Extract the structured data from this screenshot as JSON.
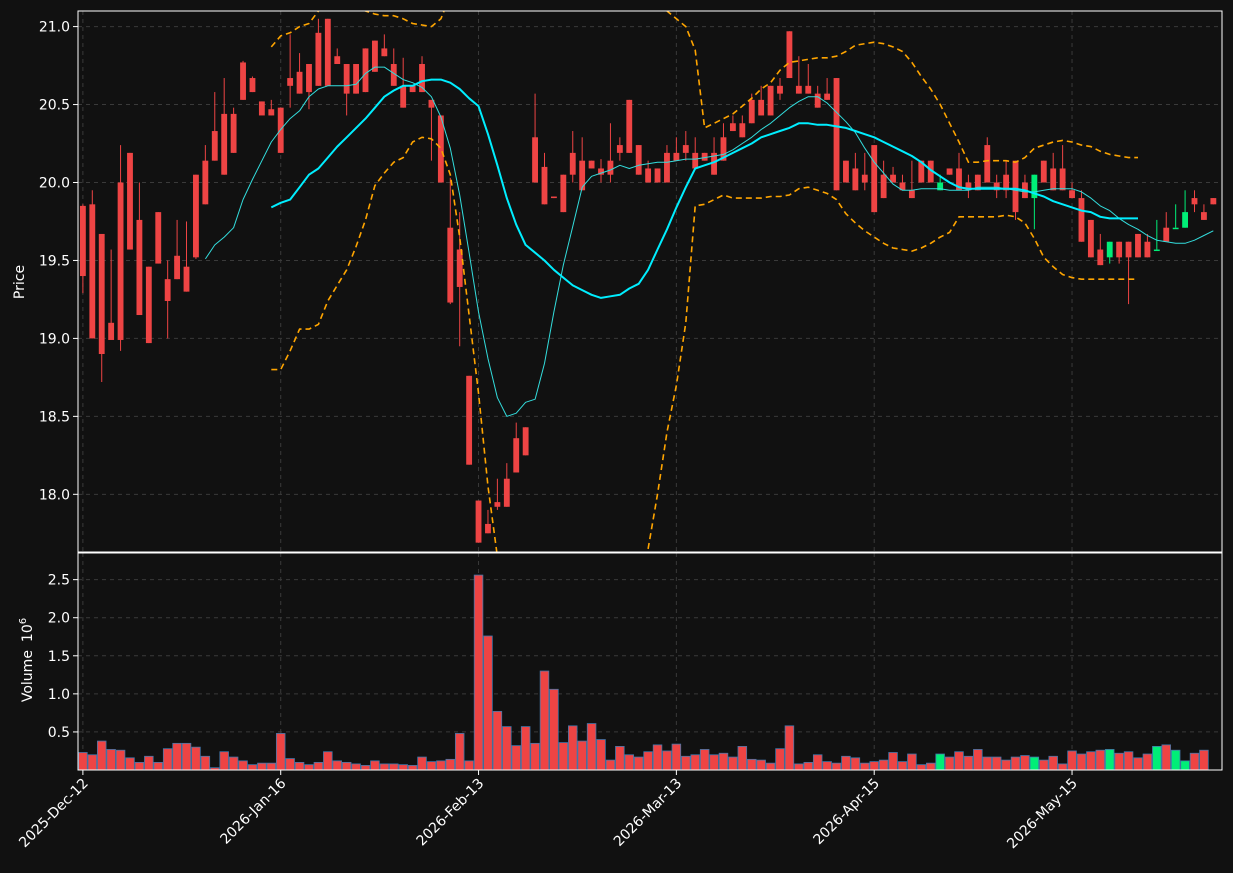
{
  "chart_data": {
    "type": "candlestick",
    "colors": {
      "background": "#111111",
      "up": "#00ee77",
      "down": "#ee4444",
      "ma_fast": "#33dddd",
      "ma_slow": "#00eeff",
      "band": "#ffa500",
      "volume_edge": "#4477aa"
    },
    "price_axis": {
      "label": "Price",
      "ylim": [
        17.63,
        21.1
      ],
      "ticks": [
        "18.0",
        "18.5",
        "19.0",
        "19.5",
        "20.0",
        "20.5",
        "21.0"
      ]
    },
    "volume_axis": {
      "label": "Volume",
      "exponent_label": "10",
      "exponent_power": "6",
      "ylim": [
        0,
        2.85
      ],
      "ticks": [
        "0.5",
        "1.0",
        "1.5",
        "2.0",
        "2.5"
      ]
    },
    "date_ticks": [
      {
        "index": 0,
        "label": "2025-Dec-12"
      },
      {
        "index": 21,
        "label": "2026-Jan-16"
      },
      {
        "index": 42,
        "label": "2026-Feb-13"
      },
      {
        "index": 63,
        "label": "2026-Mar-13"
      },
      {
        "index": 84,
        "label": "2026-Apr-15"
      },
      {
        "index": 105,
        "label": "2026-May-15"
      }
    ],
    "grid": true,
    "candles": [
      [
        19.85,
        19.86,
        19.29,
        19.4
      ],
      [
        19.86,
        19.95,
        19.0,
        19.0
      ],
      [
        19.67,
        19.67,
        18.72,
        18.9
      ],
      [
        19.1,
        19.57,
        19.0,
        18.99
      ],
      [
        20.0,
        20.24,
        18.92,
        18.99
      ],
      [
        20.19,
        20.19,
        19.57,
        19.57
      ],
      [
        19.76,
        20.0,
        19.15,
        19.15
      ],
      [
        19.46,
        19.46,
        18.97,
        18.97
      ],
      [
        19.81,
        19.81,
        19.48,
        19.48
      ],
      [
        19.38,
        19.5,
        19.0,
        19.24
      ],
      [
        19.53,
        19.76,
        19.38,
        19.38
      ],
      [
        19.46,
        19.75,
        19.3,
        19.3
      ],
      [
        20.05,
        20.05,
        19.51,
        19.52
      ],
      [
        20.14,
        20.24,
        19.86,
        19.86
      ],
      [
        20.33,
        20.58,
        20.14,
        20.14
      ],
      [
        20.44,
        20.67,
        20.05,
        20.05
      ],
      [
        20.44,
        20.48,
        20.19,
        20.19
      ],
      [
        20.77,
        20.78,
        20.53,
        20.53
      ],
      [
        20.67,
        20.68,
        20.58,
        20.58
      ],
      [
        20.52,
        20.52,
        20.44,
        20.43
      ],
      [
        20.47,
        20.53,
        20.43,
        20.43
      ],
      [
        20.48,
        20.48,
        20.19,
        20.19
      ],
      [
        20.67,
        20.95,
        20.48,
        20.62
      ],
      [
        20.71,
        20.83,
        20.57,
        20.57
      ],
      [
        20.76,
        20.76,
        20.47,
        20.58
      ],
      [
        20.96,
        21.05,
        20.62,
        20.62
      ],
      [
        21.05,
        21.05,
        20.62,
        20.62
      ],
      [
        20.81,
        20.86,
        20.76,
        20.76
      ],
      [
        20.76,
        20.76,
        20.43,
        20.57
      ],
      [
        20.76,
        20.76,
        20.57,
        20.57
      ],
      [
        20.86,
        20.86,
        20.58,
        20.58
      ],
      [
        20.91,
        20.91,
        20.71,
        20.71
      ],
      [
        20.86,
        20.95,
        20.81,
        20.81
      ],
      [
        20.76,
        20.86,
        20.62,
        20.62
      ],
      [
        20.62,
        20.8,
        20.48,
        20.48
      ],
      [
        20.62,
        20.62,
        20.58,
        20.58
      ],
      [
        20.76,
        20.81,
        20.58,
        20.58
      ],
      [
        20.53,
        20.53,
        20.14,
        20.48
      ],
      [
        20.43,
        20.43,
        20.0,
        20.0
      ],
      [
        19.71,
        20.03,
        19.22,
        19.23
      ],
      [
        19.57,
        19.81,
        18.95,
        19.33
      ],
      [
        18.76,
        18.76,
        18.19,
        18.19
      ],
      [
        17.96,
        17.96,
        17.69,
        17.69
      ],
      [
        17.81,
        17.9,
        17.75,
        17.75
      ],
      [
        17.95,
        18.1,
        17.9,
        17.92
      ],
      [
        18.1,
        18.2,
        17.92,
        17.92
      ],
      [
        18.36,
        18.46,
        18.14,
        18.14
      ],
      [
        18.43,
        18.43,
        18.25,
        18.25
      ],
      [
        20.29,
        20.57,
        20.0,
        20.0
      ],
      [
        20.1,
        20.19,
        19.86,
        19.86
      ],
      [
        19.91,
        19.91,
        19.9,
        19.9
      ],
      [
        20.05,
        20.05,
        19.81,
        19.81
      ],
      [
        20.19,
        20.33,
        20.0,
        20.05
      ],
      [
        20.14,
        20.29,
        19.95,
        19.95
      ],
      [
        20.14,
        20.14,
        20.09,
        20.09
      ],
      [
        20.09,
        20.15,
        20.0,
        20.05
      ],
      [
        20.14,
        20.38,
        20.0,
        20.05
      ],
      [
        20.24,
        20.29,
        20.14,
        20.19
      ],
      [
        20.53,
        20.53,
        20.19,
        20.19
      ],
      [
        20.24,
        20.24,
        20.05,
        20.05
      ],
      [
        20.09,
        20.14,
        20.0,
        20.0
      ],
      [
        20.09,
        20.09,
        20.0,
        20.0
      ],
      [
        20.19,
        20.24,
        20.0,
        20.0
      ],
      [
        20.19,
        20.29,
        20.14,
        20.14
      ],
      [
        20.24,
        20.33,
        20.14,
        20.19
      ],
      [
        20.19,
        20.29,
        20.09,
        20.09
      ],
      [
        20.19,
        20.19,
        20.14,
        20.14
      ],
      [
        20.19,
        20.29,
        20.05,
        20.05
      ],
      [
        20.29,
        20.38,
        20.14,
        20.14
      ],
      [
        20.38,
        20.43,
        20.33,
        20.33
      ],
      [
        20.38,
        20.43,
        20.29,
        20.29
      ],
      [
        20.53,
        20.57,
        20.38,
        20.38
      ],
      [
        20.53,
        20.62,
        20.43,
        20.43
      ],
      [
        20.62,
        20.62,
        20.43,
        20.43
      ],
      [
        20.62,
        20.67,
        20.53,
        20.57
      ],
      [
        20.97,
        20.97,
        20.67,
        20.67
      ],
      [
        20.62,
        20.81,
        20.57,
        20.57
      ],
      [
        20.62,
        20.76,
        20.57,
        20.57
      ],
      [
        20.57,
        20.62,
        20.48,
        20.48
      ],
      [
        20.57,
        20.67,
        20.53,
        20.53
      ],
      [
        20.67,
        20.67,
        19.95,
        19.95
      ],
      [
        20.14,
        20.14,
        20.0,
        20.0
      ],
      [
        20.09,
        20.19,
        19.95,
        19.95
      ],
      [
        20.05,
        20.19,
        19.95,
        20.0
      ],
      [
        20.24,
        20.24,
        19.81,
        19.81
      ],
      [
        20.05,
        20.14,
        19.9,
        19.9
      ],
      [
        20.05,
        20.1,
        20.0,
        20.0
      ],
      [
        20.0,
        20.05,
        19.95,
        19.95
      ],
      [
        19.95,
        20.14,
        19.9,
        19.9
      ],
      [
        20.14,
        20.14,
        20.0,
        20.0
      ],
      [
        20.14,
        20.14,
        20.0,
        20.0
      ],
      [
        19.95,
        20.05,
        19.95,
        20.0
      ],
      [
        20.09,
        20.09,
        20.05,
        20.05
      ],
      [
        20.09,
        20.19,
        19.95,
        19.95
      ],
      [
        20.0,
        20.05,
        19.9,
        19.95
      ],
      [
        20.05,
        20.05,
        19.95,
        19.95
      ],
      [
        20.24,
        20.29,
        20.0,
        20.0
      ],
      [
        20.0,
        20.05,
        19.9,
        19.95
      ],
      [
        20.05,
        20.14,
        19.9,
        19.95
      ],
      [
        20.14,
        20.14,
        19.76,
        19.81
      ],
      [
        20.0,
        20.05,
        19.9,
        19.9
      ],
      [
        19.9,
        20.05,
        19.7,
        20.05
      ],
      [
        20.14,
        20.14,
        20.0,
        20.0
      ],
      [
        20.09,
        20.19,
        19.95,
        19.95
      ],
      [
        20.09,
        20.24,
        19.95,
        19.95
      ],
      [
        19.95,
        20.0,
        19.9,
        19.9
      ],
      [
        19.9,
        19.95,
        19.62,
        19.62
      ],
      [
        19.76,
        19.76,
        19.52,
        19.52
      ],
      [
        19.57,
        19.67,
        19.47,
        19.47
      ],
      [
        19.52,
        19.62,
        19.48,
        19.62
      ],
      [
        19.62,
        19.62,
        19.48,
        19.52
      ],
      [
        19.62,
        19.62,
        19.22,
        19.52
      ],
      [
        19.67,
        19.67,
        19.52,
        19.52
      ],
      [
        19.62,
        19.67,
        19.52,
        19.52
      ],
      [
        19.57,
        19.76,
        19.57,
        19.57
      ],
      [
        19.71,
        19.81,
        19.62,
        19.62
      ],
      [
        19.71,
        19.86,
        19.71,
        19.71
      ],
      [
        19.71,
        19.95,
        19.71,
        19.81
      ],
      [
        19.9,
        19.95,
        19.81,
        19.86
      ],
      [
        19.81,
        19.86,
        19.76,
        19.76
      ],
      [
        19.9,
        19.9,
        19.86,
        19.86
      ]
    ],
    "volume": [
      0.23,
      0.2,
      0.38,
      0.27,
      0.26,
      0.16,
      0.1,
      0.18,
      0.1,
      0.28,
      0.35,
      0.35,
      0.3,
      0.18,
      0.03,
      0.24,
      0.17,
      0.12,
      0.07,
      0.09,
      0.09,
      0.48,
      0.15,
      0.1,
      0.07,
      0.1,
      0.24,
      0.12,
      0.1,
      0.08,
      0.06,
      0.12,
      0.08,
      0.08,
      0.07,
      0.06,
      0.17,
      0.11,
      0.12,
      0.14,
      0.48,
      0.12,
      2.56,
      1.76,
      0.77,
      0.57,
      0.32,
      0.57,
      0.35,
      1.3,
      1.06,
      0.36,
      0.58,
      0.38,
      0.61,
      0.4,
      0.13,
      0.31,
      0.2,
      0.17,
      0.24,
      0.33,
      0.25,
      0.34,
      0.18,
      0.2,
      0.27,
      0.2,
      0.22,
      0.17,
      0.31,
      0.14,
      0.13,
      0.09,
      0.28,
      0.58,
      0.08,
      0.1,
      0.2,
      0.11,
      0.09,
      0.18,
      0.16,
      0.09,
      0.11,
      0.13,
      0.23,
      0.11,
      0.21,
      0.07,
      0.09,
      0.21,
      0.17,
      0.24,
      0.18,
      0.27,
      0.17,
      0.17,
      0.13,
      0.17,
      0.19,
      0.17,
      0.13,
      0.18,
      0.08,
      0.25,
      0.21,
      0.24,
      0.26,
      0.27,
      0.22,
      0.24,
      0.16,
      0.21,
      0.31,
      0.33,
      0.26,
      0.12,
      0.22,
      0.26
    ],
    "ma_fast": [
      null,
      null,
      null,
      null,
      null,
      null,
      null,
      null,
      null,
      null,
      null,
      null,
      null,
      19.51,
      19.6,
      19.65,
      19.71,
      19.89,
      20.02,
      20.14,
      20.26,
      20.34,
      20.41,
      20.46,
      20.55,
      20.6,
      20.62,
      20.62,
      20.62,
      20.63,
      20.7,
      20.74,
      20.74,
      20.7,
      20.66,
      20.64,
      20.61,
      20.55,
      20.42,
      20.22,
      19.92,
      19.55,
      19.17,
      18.87,
      18.62,
      18.5,
      18.52,
      18.59,
      18.61,
      18.84,
      19.17,
      19.47,
      19.72,
      19.97,
      20.04,
      20.06,
      20.08,
      20.11,
      20.09,
      20.11,
      20.12,
      20.13,
      20.13,
      20.14,
      20.15,
      20.15,
      20.16,
      20.17,
      20.18,
      20.21,
      20.25,
      20.29,
      20.34,
      20.38,
      20.43,
      20.48,
      20.52,
      20.55,
      20.55,
      20.51,
      20.45,
      20.39,
      20.32,
      20.22,
      20.13,
      20.06,
      19.99,
      19.95,
      19.95,
      19.96,
      19.96,
      19.96,
      19.95,
      19.95,
      19.95,
      19.97,
      19.97,
      19.97,
      19.96,
      19.95,
      19.94,
      19.94,
      19.95,
      19.96,
      19.96,
      19.96,
      19.94,
      19.9,
      19.85,
      19.82,
      19.77,
      19.73,
      19.7,
      19.66,
      19.63,
      19.62,
      19.61,
      19.61,
      19.63,
      19.66,
      19.69
    ],
    "ma_slow": [
      null,
      null,
      null,
      null,
      null,
      null,
      null,
      null,
      null,
      null,
      null,
      null,
      null,
      null,
      null,
      null,
      null,
      null,
      null,
      null,
      19.84,
      19.87,
      19.89,
      19.97,
      20.05,
      20.09,
      20.16,
      20.23,
      20.29,
      20.35,
      20.41,
      20.48,
      20.55,
      20.59,
      20.62,
      20.62,
      20.65,
      20.66,
      20.66,
      20.64,
      20.6,
      20.54,
      20.49,
      20.31,
      20.11,
      19.9,
      19.73,
      19.6,
      19.55,
      19.5,
      19.44,
      19.39,
      19.34,
      19.31,
      19.28,
      19.26,
      19.27,
      19.28,
      19.32,
      19.35,
      19.44,
      19.57,
      19.7,
      19.84,
      19.97,
      20.09,
      20.11,
      20.13,
      20.16,
      20.19,
      20.22,
      20.25,
      20.29,
      20.31,
      20.33,
      20.35,
      20.38,
      20.38,
      20.37,
      20.37,
      20.36,
      20.35,
      20.33,
      20.31,
      20.29,
      20.26,
      20.23,
      20.2,
      20.17,
      20.13,
      20.08,
      20.04,
      20.0,
      19.97,
      19.96,
      19.96,
      19.96,
      19.96,
      19.96,
      19.96,
      19.95,
      19.93,
      19.91,
      19.88,
      19.86,
      19.84,
      19.82,
      19.81,
      19.78,
      19.77,
      19.77,
      19.77,
      19.77
    ],
    "band_upper": [
      null,
      null,
      null,
      null,
      null,
      null,
      null,
      null,
      null,
      null,
      null,
      null,
      null,
      null,
      null,
      null,
      null,
      null,
      null,
      null,
      20.87,
      20.94,
      20.96,
      21.0,
      21.02,
      21.1,
      21.13,
      21.16,
      21.15,
      21.12,
      21.1,
      21.08,
      21.07,
      21.07,
      21.05,
      21.02,
      21.01,
      21.0,
      21.05,
      21.2,
      21.5,
      21.9,
      22.3,
      22.6,
      22.9,
      23.0,
      23.1,
      23.1,
      23.0,
      22.9,
      22.8,
      22.6,
      22.5,
      22.4,
      22.2,
      22.0,
      21.8,
      21.6,
      21.4,
      21.3,
      21.2,
      21.15,
      21.1,
      21.05,
      21.0,
      20.85,
      20.35,
      20.38,
      20.41,
      20.44,
      20.49,
      20.54,
      20.6,
      20.64,
      20.72,
      20.77,
      20.78,
      20.79,
      20.8,
      20.8,
      20.81,
      20.84,
      20.88,
      20.89,
      20.9,
      20.89,
      20.87,
      20.84,
      20.77,
      20.68,
      20.6,
      20.5,
      20.38,
      20.26,
      20.13,
      20.13,
      20.14,
      20.14,
      20.14,
      20.13,
      20.16,
      20.22,
      20.24,
      20.26,
      20.27,
      20.26,
      20.24,
      20.23,
      20.2,
      20.18,
      20.17,
      20.16,
      20.16
    ],
    "band_lower": [
      null,
      null,
      null,
      null,
      null,
      null,
      null,
      null,
      null,
      null,
      null,
      null,
      null,
      null,
      null,
      null,
      null,
      null,
      null,
      null,
      18.8,
      18.8,
      18.92,
      19.06,
      19.06,
      19.09,
      19.24,
      19.34,
      19.44,
      19.59,
      19.76,
      19.98,
      20.06,
      20.13,
      20.16,
      20.26,
      20.29,
      20.28,
      20.22,
      20.05,
      19.65,
      19.15,
      18.65,
      18.05,
      17.6,
      17.4,
      17.2,
      17.0,
      16.9,
      16.8,
      16.7,
      16.6,
      16.55,
      16.5,
      16.5,
      16.5,
      16.6,
      16.8,
      17.1,
      17.4,
      17.65,
      18.0,
      18.4,
      18.7,
      19.1,
      19.85,
      19.86,
      19.89,
      19.92,
      19.9,
      19.9,
      19.9,
      19.9,
      19.91,
      19.91,
      19.92,
      19.96,
      19.97,
      19.95,
      19.93,
      19.89,
      19.8,
      19.74,
      19.69,
      19.65,
      19.61,
      19.58,
      19.57,
      19.56,
      19.58,
      19.61,
      19.65,
      19.68,
      19.78,
      19.78,
      19.78,
      19.78,
      19.78,
      19.79,
      19.78,
      19.74,
      19.64,
      19.52,
      19.46,
      19.41,
      19.39,
      19.38,
      19.38,
      19.38,
      19.38,
      19.38,
      19.38,
      19.38
    ]
  }
}
